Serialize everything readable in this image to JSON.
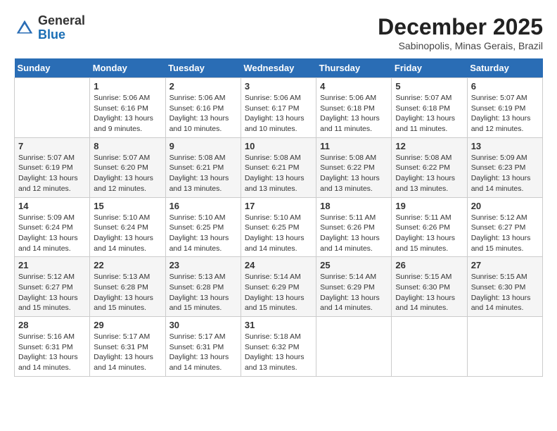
{
  "header": {
    "logo": {
      "line1": "General",
      "line2": "Blue"
    },
    "title": "December 2025",
    "location": "Sabinopolis, Minas Gerais, Brazil"
  },
  "calendar": {
    "days_of_week": [
      "Sunday",
      "Monday",
      "Tuesday",
      "Wednesday",
      "Thursday",
      "Friday",
      "Saturday"
    ],
    "weeks": [
      [
        {
          "day": "",
          "info": ""
        },
        {
          "day": "1",
          "info": "Sunrise: 5:06 AM\nSunset: 6:16 PM\nDaylight: 13 hours\nand 9 minutes."
        },
        {
          "day": "2",
          "info": "Sunrise: 5:06 AM\nSunset: 6:16 PM\nDaylight: 13 hours\nand 10 minutes."
        },
        {
          "day": "3",
          "info": "Sunrise: 5:06 AM\nSunset: 6:17 PM\nDaylight: 13 hours\nand 10 minutes."
        },
        {
          "day": "4",
          "info": "Sunrise: 5:06 AM\nSunset: 6:18 PM\nDaylight: 13 hours\nand 11 minutes."
        },
        {
          "day": "5",
          "info": "Sunrise: 5:07 AM\nSunset: 6:18 PM\nDaylight: 13 hours\nand 11 minutes."
        },
        {
          "day": "6",
          "info": "Sunrise: 5:07 AM\nSunset: 6:19 PM\nDaylight: 13 hours\nand 12 minutes."
        }
      ],
      [
        {
          "day": "7",
          "info": "Sunrise: 5:07 AM\nSunset: 6:19 PM\nDaylight: 13 hours\nand 12 minutes."
        },
        {
          "day": "8",
          "info": "Sunrise: 5:07 AM\nSunset: 6:20 PM\nDaylight: 13 hours\nand 12 minutes."
        },
        {
          "day": "9",
          "info": "Sunrise: 5:08 AM\nSunset: 6:21 PM\nDaylight: 13 hours\nand 13 minutes."
        },
        {
          "day": "10",
          "info": "Sunrise: 5:08 AM\nSunset: 6:21 PM\nDaylight: 13 hours\nand 13 minutes."
        },
        {
          "day": "11",
          "info": "Sunrise: 5:08 AM\nSunset: 6:22 PM\nDaylight: 13 hours\nand 13 minutes."
        },
        {
          "day": "12",
          "info": "Sunrise: 5:08 AM\nSunset: 6:22 PM\nDaylight: 13 hours\nand 13 minutes."
        },
        {
          "day": "13",
          "info": "Sunrise: 5:09 AM\nSunset: 6:23 PM\nDaylight: 13 hours\nand 14 minutes."
        }
      ],
      [
        {
          "day": "14",
          "info": "Sunrise: 5:09 AM\nSunset: 6:24 PM\nDaylight: 13 hours\nand 14 minutes."
        },
        {
          "day": "15",
          "info": "Sunrise: 5:10 AM\nSunset: 6:24 PM\nDaylight: 13 hours\nand 14 minutes."
        },
        {
          "day": "16",
          "info": "Sunrise: 5:10 AM\nSunset: 6:25 PM\nDaylight: 13 hours\nand 14 minutes."
        },
        {
          "day": "17",
          "info": "Sunrise: 5:10 AM\nSunset: 6:25 PM\nDaylight: 13 hours\nand 14 minutes."
        },
        {
          "day": "18",
          "info": "Sunrise: 5:11 AM\nSunset: 6:26 PM\nDaylight: 13 hours\nand 14 minutes."
        },
        {
          "day": "19",
          "info": "Sunrise: 5:11 AM\nSunset: 6:26 PM\nDaylight: 13 hours\nand 15 minutes."
        },
        {
          "day": "20",
          "info": "Sunrise: 5:12 AM\nSunset: 6:27 PM\nDaylight: 13 hours\nand 15 minutes."
        }
      ],
      [
        {
          "day": "21",
          "info": "Sunrise: 5:12 AM\nSunset: 6:27 PM\nDaylight: 13 hours\nand 15 minutes."
        },
        {
          "day": "22",
          "info": "Sunrise: 5:13 AM\nSunset: 6:28 PM\nDaylight: 13 hours\nand 15 minutes."
        },
        {
          "day": "23",
          "info": "Sunrise: 5:13 AM\nSunset: 6:28 PM\nDaylight: 13 hours\nand 15 minutes."
        },
        {
          "day": "24",
          "info": "Sunrise: 5:14 AM\nSunset: 6:29 PM\nDaylight: 13 hours\nand 15 minutes."
        },
        {
          "day": "25",
          "info": "Sunrise: 5:14 AM\nSunset: 6:29 PM\nDaylight: 13 hours\nand 14 minutes."
        },
        {
          "day": "26",
          "info": "Sunrise: 5:15 AM\nSunset: 6:30 PM\nDaylight: 13 hours\nand 14 minutes."
        },
        {
          "day": "27",
          "info": "Sunrise: 5:15 AM\nSunset: 6:30 PM\nDaylight: 13 hours\nand 14 minutes."
        }
      ],
      [
        {
          "day": "28",
          "info": "Sunrise: 5:16 AM\nSunset: 6:31 PM\nDaylight: 13 hours\nand 14 minutes."
        },
        {
          "day": "29",
          "info": "Sunrise: 5:17 AM\nSunset: 6:31 PM\nDaylight: 13 hours\nand 14 minutes."
        },
        {
          "day": "30",
          "info": "Sunrise: 5:17 AM\nSunset: 6:31 PM\nDaylight: 13 hours\nand 14 minutes."
        },
        {
          "day": "31",
          "info": "Sunrise: 5:18 AM\nSunset: 6:32 PM\nDaylight: 13 hours\nand 13 minutes."
        },
        {
          "day": "",
          "info": ""
        },
        {
          "day": "",
          "info": ""
        },
        {
          "day": "",
          "info": ""
        }
      ]
    ]
  }
}
